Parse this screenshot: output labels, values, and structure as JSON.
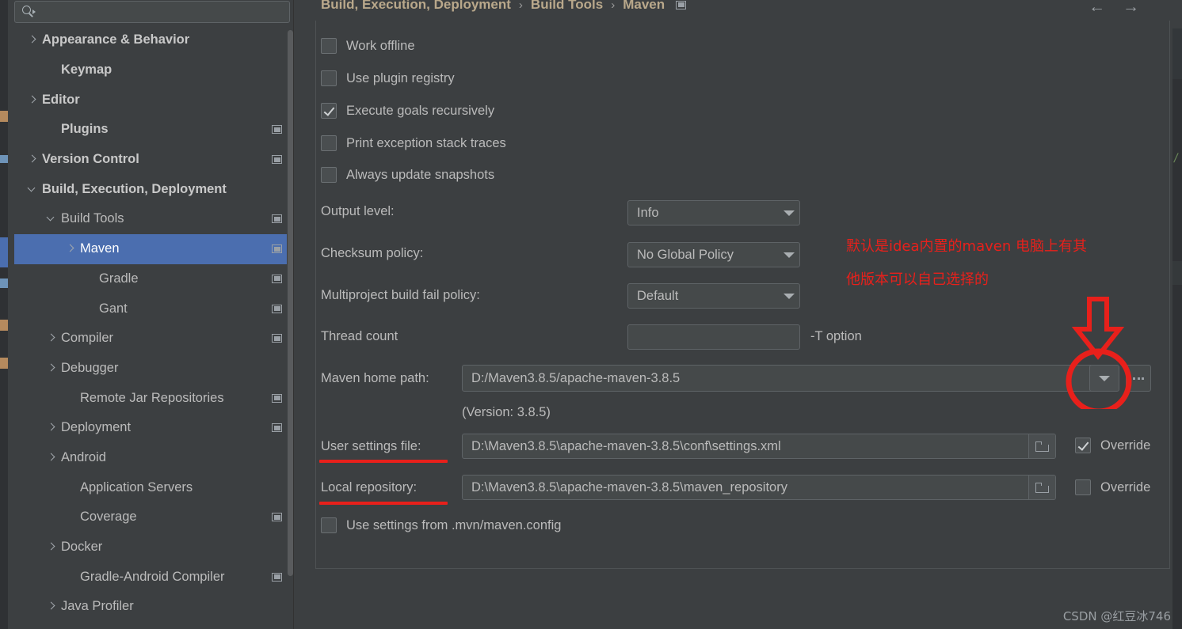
{
  "window": {
    "background_color": "#3c3f41",
    "accent_selection": "#4b6eaf",
    "annotation_color": "#e8201b"
  },
  "search": {
    "value": "",
    "placeholder": "",
    "icon": "search-icon"
  },
  "sidebar": {
    "items": [
      {
        "label": "Appearance & Behavior",
        "arrow": "right",
        "bold": true,
        "indent": 16,
        "badge": false,
        "selected": false
      },
      {
        "label": "Keymap",
        "arrow": "none",
        "bold": true,
        "indent": 40,
        "badge": false,
        "selected": false
      },
      {
        "label": "Editor",
        "arrow": "right",
        "bold": true,
        "indent": 16,
        "badge": false,
        "selected": false
      },
      {
        "label": "Plugins",
        "arrow": "none",
        "bold": true,
        "indent": 40,
        "badge": true,
        "selected": false
      },
      {
        "label": "Version Control",
        "arrow": "right",
        "bold": true,
        "indent": 16,
        "badge": true,
        "selected": false
      },
      {
        "label": "Build, Execution, Deployment",
        "arrow": "down",
        "bold": true,
        "indent": 16,
        "badge": false,
        "selected": false
      },
      {
        "label": "Build Tools",
        "arrow": "down",
        "bold": false,
        "indent": 40,
        "badge": true,
        "selected": false
      },
      {
        "label": "Maven",
        "arrow": "right",
        "bold": false,
        "indent": 64,
        "badge": true,
        "selected": true
      },
      {
        "label": "Gradle",
        "arrow": "none",
        "bold": false,
        "indent": 88,
        "badge": true,
        "selected": false
      },
      {
        "label": "Gant",
        "arrow": "none",
        "bold": false,
        "indent": 88,
        "badge": true,
        "selected": false
      },
      {
        "label": "Compiler",
        "arrow": "right",
        "bold": false,
        "indent": 40,
        "badge": true,
        "selected": false
      },
      {
        "label": "Debugger",
        "arrow": "right",
        "bold": false,
        "indent": 40,
        "badge": false,
        "selected": false
      },
      {
        "label": "Remote Jar Repositories",
        "arrow": "none",
        "bold": false,
        "indent": 64,
        "badge": true,
        "selected": false
      },
      {
        "label": "Deployment",
        "arrow": "right",
        "bold": false,
        "indent": 40,
        "badge": true,
        "selected": false
      },
      {
        "label": "Android",
        "arrow": "right",
        "bold": false,
        "indent": 40,
        "badge": false,
        "selected": false
      },
      {
        "label": "Application Servers",
        "arrow": "none",
        "bold": false,
        "indent": 64,
        "badge": false,
        "selected": false
      },
      {
        "label": "Coverage",
        "arrow": "none",
        "bold": false,
        "indent": 64,
        "badge": true,
        "selected": false
      },
      {
        "label": "Docker",
        "arrow": "right",
        "bold": false,
        "indent": 40,
        "badge": false,
        "selected": false
      },
      {
        "label": "Gradle-Android Compiler",
        "arrow": "none",
        "bold": false,
        "indent": 64,
        "badge": true,
        "selected": false
      },
      {
        "label": "Java Profiler",
        "arrow": "right",
        "bold": false,
        "indent": 40,
        "badge": false,
        "selected": false
      }
    ]
  },
  "breadcrumb": {
    "crumb1": "Build, Execution, Deployment",
    "crumb2": "Build Tools",
    "crumb3": "Maven",
    "separator": "›"
  },
  "nav": {
    "back": "←",
    "forward": "→"
  },
  "settings": {
    "checkboxes": [
      {
        "label": "Work offline",
        "checked": false
      },
      {
        "label": "Use plugin registry",
        "checked": false
      },
      {
        "label": "Execute goals recursively",
        "checked": true
      },
      {
        "label": "Print exception stack traces",
        "checked": false
      },
      {
        "label": "Always update snapshots",
        "checked": false
      }
    ],
    "output_level": {
      "label": "Output level:",
      "value": "Info"
    },
    "checksum_policy": {
      "label": "Checksum policy:",
      "value": "No Global Policy"
    },
    "multiproject_policy": {
      "label": "Multiproject build fail policy:",
      "value": "Default"
    },
    "thread_count": {
      "label": "Thread count",
      "value": "",
      "suffix": "-T option"
    },
    "maven_home": {
      "label": "Maven home path:",
      "value": "D:/Maven3.8.5/apache-maven-3.8.5",
      "version_note": "(Version: 3.8.5)"
    },
    "user_settings": {
      "label": "User settings file:",
      "value": "D:\\Maven3.8.5\\apache-maven-3.8.5\\conf\\settings.xml",
      "override_label": "Override",
      "override_checked": true
    },
    "local_repository": {
      "label": "Local repository:",
      "value": "D:\\Maven3.8.5\\apache-maven-3.8.5\\maven_repository",
      "override_label": "Override",
      "override_checked": false
    },
    "mvn_config": {
      "label": "Use settings from .mvn/maven.config",
      "checked": false
    }
  },
  "annotations": {
    "note_line1": "默认是idea内置的maven 电脑上有其",
    "note_line2": "他版本可以自己选择的"
  },
  "watermark": {
    "text": "CSDN @红豆冰746"
  },
  "background_code": {
    "right_snippet": "d/"
  }
}
